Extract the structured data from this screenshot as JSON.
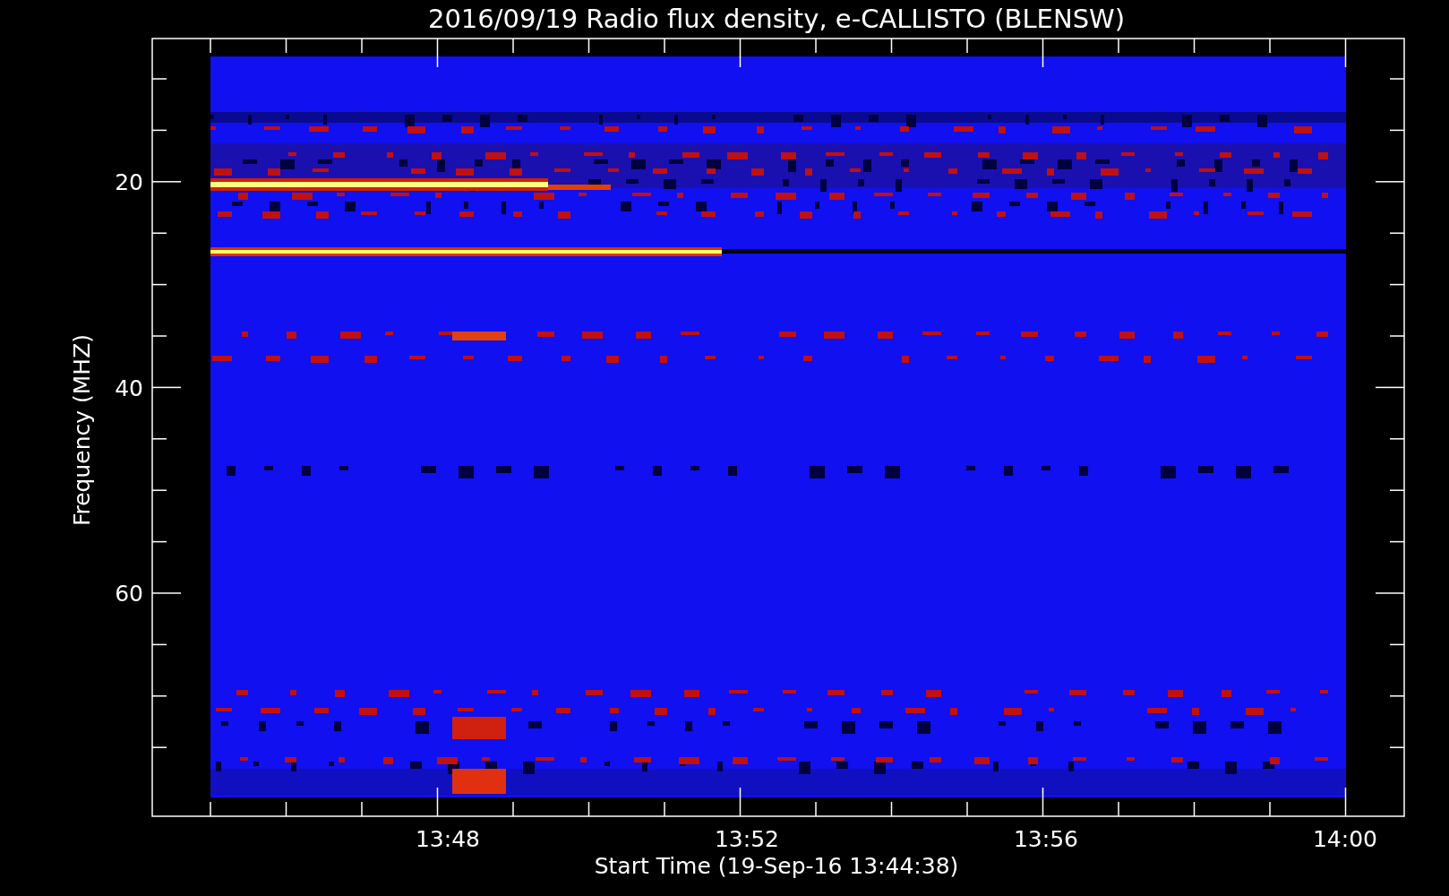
{
  "title": "2016/09/19  Radio flux density, e-CALLISTO (BLENSW)",
  "y_axis": {
    "label": "Frequency (MHZ)",
    "ticks": [
      "20",
      "40",
      "60"
    ]
  },
  "x_axis": {
    "label": "Start Time (19-Sep-16 13:44:38)",
    "ticks": [
      "13:48",
      "13:52",
      "13:56",
      "14:00"
    ]
  }
}
